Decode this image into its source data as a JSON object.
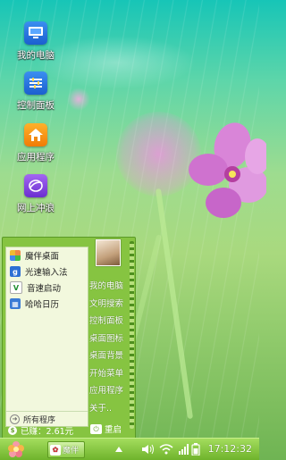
{
  "desktop": {
    "icons": [
      {
        "label": "我的电脑",
        "icon": "computer-icon"
      },
      {
        "label": "控制面板",
        "icon": "sliders-icon"
      },
      {
        "label": "应用程序",
        "icon": "home-icon"
      },
      {
        "label": "网上冲浪",
        "icon": "globe-icon"
      }
    ]
  },
  "start_menu": {
    "programs": [
      {
        "label": "魔伴桌面",
        "icon": "mobanzhuomian-icon"
      },
      {
        "label": "光速输入法",
        "icon": "input-method-icon"
      },
      {
        "label": "音速启动",
        "icon": "vstart-icon"
      },
      {
        "label": "哈哈日历",
        "icon": "calendar-icon"
      }
    ],
    "all_programs": "所有程序",
    "right_items": [
      "我的电脑",
      "文明搜索",
      "控制面板",
      "桌面图标",
      "桌面背景",
      "开始菜单",
      "应用程序",
      "关于.."
    ],
    "earned": "已赚：2.61元",
    "restart": "重启"
  },
  "taskbar": {
    "task_label": "魔伴",
    "clock": "17:12:32",
    "tray_icons": [
      "chevron-up-icon",
      "volume-icon",
      "wifi-icon",
      "signal-icon",
      "battery-icon"
    ]
  },
  "colors": {
    "menu_green": "#86c441",
    "taskbar_green": "#6fb32c"
  }
}
